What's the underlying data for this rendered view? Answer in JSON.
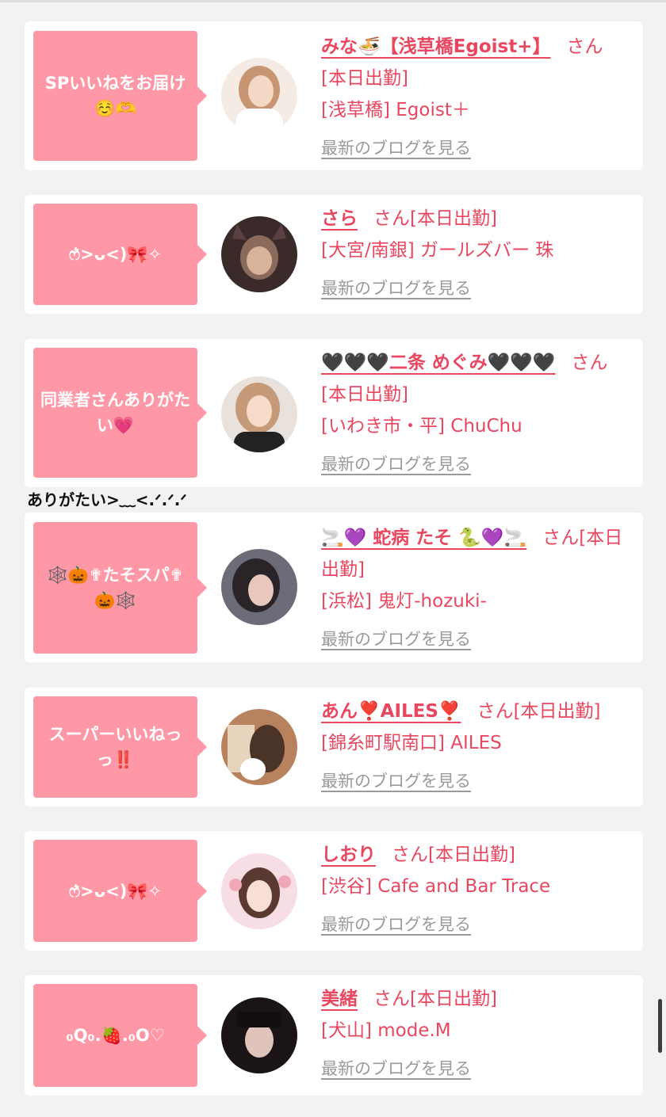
{
  "colors": {
    "accent": "#e8475f",
    "bubble": "#ff98a6",
    "link_gray": "#9a9a9a",
    "background": "#f2f2f2"
  },
  "blog_label": "最新のブログを見る",
  "caption": "ありがたい>﹏<.ᐟ.ᐟ.ᐟ",
  "cards": [
    {
      "bubble": "SPいいねをお届け☺️🫶",
      "name": "みな🍜【浅草橋Egoist+】",
      "suffix": "さん",
      "status": "[本日出勤]",
      "shop": "[浅草橋] Egoist＋",
      "avatar_icon": "profile-photo"
    },
    {
      "bubble": "ෆ͛>ᴗ<)🎀✧",
      "name": "さら",
      "suffix": "さん",
      "status": "[本日出勤]",
      "shop": "[大宮/南銀] ガールズバー 珠",
      "avatar_icon": "profile-photo"
    },
    {
      "bubble": "同業者さんありがたい💗",
      "name": "🖤🖤🖤二条 めぐみ🖤🖤🖤",
      "suffix": "さん",
      "status": "[本日出勤]",
      "shop": "[いわき市・平] ChuChu",
      "avatar_icon": "profile-photo"
    },
    {
      "bubble": "🕸️🎃✟たそスパ✟🎃🕸️",
      "name": "🚬💜 蛇病 たそ 🐍💜🚬",
      "suffix": "さん",
      "status": "[本日出勤]",
      "shop": "[浜松] 鬼灯-hozuki-",
      "avatar_icon": "profile-photo"
    },
    {
      "bubble": "スーパーいいねっっ‼️",
      "name": "あん❣️AILES❣️",
      "suffix": "さん",
      "status": "[本日出勤]",
      "shop": "[錦糸町駅南口] AILES",
      "avatar_icon": "profile-photo"
    },
    {
      "bubble": "ෆ͛>ᴗ<)🎀✧",
      "name": "しおり",
      "suffix": "さん",
      "status": "[本日出勤]",
      "shop": "[渋谷] Cafe and Bar Trace",
      "avatar_icon": "profile-photo"
    },
    {
      "bubble": "₀Q₀.🍓.₀O♡",
      "name": "美緒",
      "suffix": "さん",
      "status": "[本日出勤]",
      "shop": "[犬山] mode.M",
      "avatar_icon": "profile-photo"
    }
  ]
}
